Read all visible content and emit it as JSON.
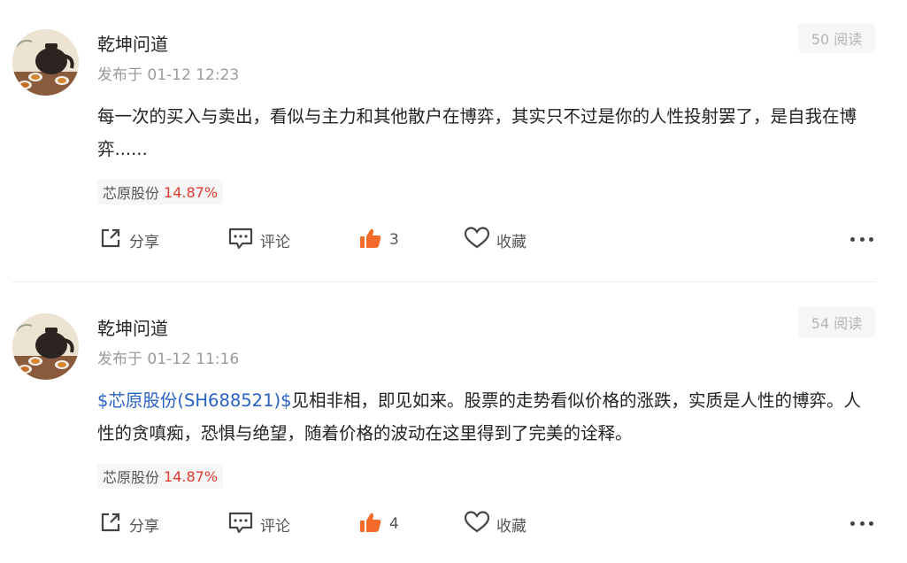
{
  "posts": [
    {
      "username": "乾坤问道",
      "timestamp": "发布于 01-12 12:23",
      "views": "50 阅读",
      "content_link": "",
      "content_text": "每一次的买入与卖出，看似与主力和其他散户在博弈，其实只不过是你的人性投射罢了，是自我在博弈......",
      "stock_tag": {
        "name": "芯原股份",
        "change": "14.87%"
      },
      "actions": {
        "share": "分享",
        "comment": "评论",
        "like_count": "3",
        "favorite": "收藏"
      }
    },
    {
      "username": "乾坤问道",
      "timestamp": "发布于 01-12 11:16",
      "views": "54 阅读",
      "content_link": "$芯原股份(SH688521)$",
      "content_text": "见相非相，即见如来。股票的走势看似价格的涨跌，实质是人性的博弈。人性的贪嗔痴，恐惧与绝望，随着价格的波动在这里得到了完美的诠释。",
      "stock_tag": {
        "name": "芯原股份",
        "change": "14.87%"
      },
      "actions": {
        "share": "分享",
        "comment": "评论",
        "like_count": "4",
        "favorite": "收藏"
      }
    }
  ],
  "colors": {
    "link": "#2862c4",
    "up": "#e03b2e",
    "like_icon": "#f46a28",
    "muted": "#9a9a9a"
  },
  "icons": [
    "avatar",
    "share-icon",
    "comment-icon",
    "thumbs-up-icon",
    "heart-icon",
    "more-icon"
  ]
}
